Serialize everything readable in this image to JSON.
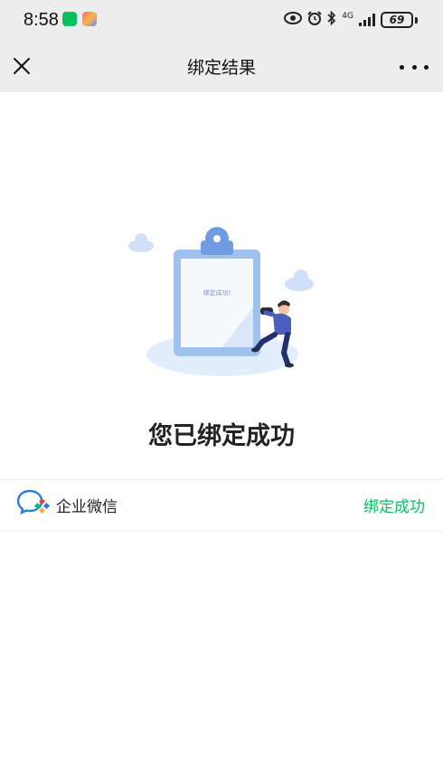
{
  "status_bar": {
    "time": "8:58",
    "network_label": "4G",
    "battery_level": "69",
    "icons": [
      "wechat-notification-icon",
      "app-notification-icon",
      "eye-icon",
      "alarm-icon",
      "bluetooth-icon",
      "signal-icon",
      "battery-icon"
    ]
  },
  "nav": {
    "title": "绑定结果",
    "close_icon": "close-icon",
    "more_icon": "more-icon"
  },
  "illustration": {
    "clipboard_text": "绑定成功!"
  },
  "result": {
    "title": "您已绑定成功"
  },
  "binding_row": {
    "app_name": "企业微信",
    "status": "绑定成功",
    "status_color": "#07c160",
    "logo_icon": "wecom-logo-icon"
  },
  "colors": {
    "accent": "#07c160",
    "header_bg": "#ededed"
  }
}
